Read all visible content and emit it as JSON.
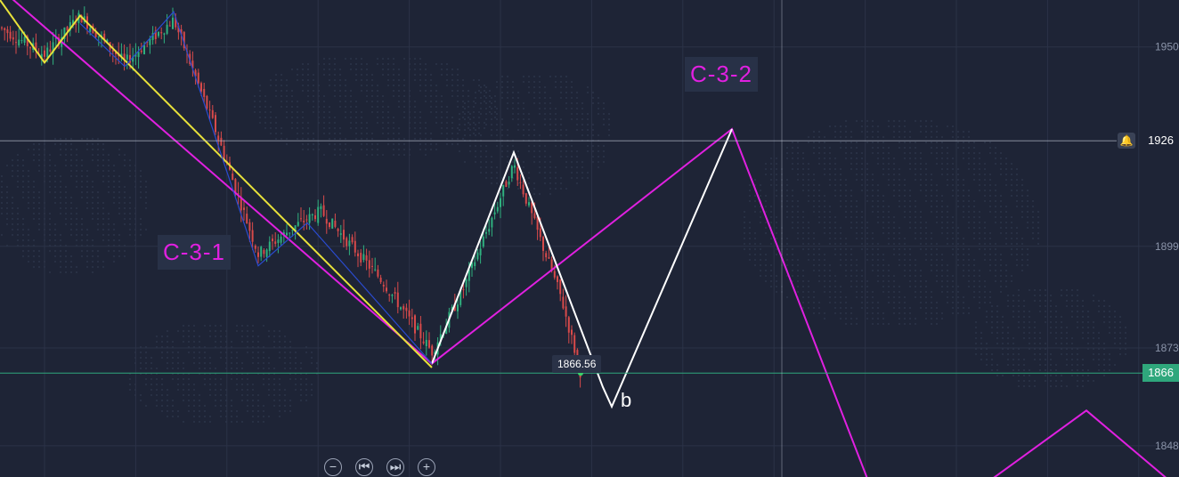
{
  "chart_data": {
    "type": "candlestick",
    "title": "",
    "xlabel": "",
    "ylabel": "",
    "ylim": [
      1840,
      1962
    ],
    "price_axis_ticks": [
      "1950",
      "1926",
      "1899",
      "1873",
      "1866",
      "1848"
    ],
    "current_price": 1866.56,
    "current_price_label": "1866",
    "crosshair_price_label": "1926",
    "tooltip_value": "1866.56",
    "grid": true,
    "wave_labels": [
      "C-3-1",
      "C-3-2",
      "b"
    ],
    "candles_desc": "downtrend then rebound then decline",
    "series": [
      {
        "name": "",
        "color": "#e020e0",
        "points": [
          [
            0,
            1965
          ],
          [
            485,
            1869
          ],
          [
            822,
            1929
          ],
          [
            975,
            1839
          ]
        ]
      },
      {
        "name": "",
        "color": "#e020e0",
        "points": [
          [
            1105,
            1838
          ],
          [
            1220,
            1857
          ],
          [
            1324,
            1837
          ]
        ]
      },
      {
        "name": "",
        "color": "#ffffff",
        "points": [
          [
            485,
            1869
          ],
          [
            577,
            1923
          ],
          [
            677,
            1863
          ],
          [
            687,
            1858
          ],
          [
            822,
            1929
          ]
        ]
      },
      {
        "name": "",
        "color": "#e8e23a",
        "points": [
          [
            0,
            1962
          ],
          [
            50,
            1946
          ],
          [
            90,
            1958
          ],
          [
            485,
            1868
          ]
        ]
      },
      {
        "name": "",
        "color": "#2a4bd0",
        "points": [
          [
            90,
            1956
          ],
          [
            140,
            1945
          ],
          [
            195,
            1959
          ],
          [
            290,
            1894
          ],
          [
            345,
            1905
          ],
          [
            485,
            1869
          ]
        ]
      }
    ]
  },
  "ui": {
    "alert_icon": "bell-icon",
    "controls": [
      {
        "name": "zoom-out-button",
        "glyph": "−"
      },
      {
        "name": "scroll-start-button",
        "glyph": "⏮"
      },
      {
        "name": "scroll-end-button",
        "glyph": "⏭"
      },
      {
        "name": "zoom-in-button",
        "glyph": "+"
      }
    ],
    "colors": {
      "background": "#1e2436",
      "grid": "#2b3247",
      "up_candle": "#2fb17f",
      "down_candle": "#d84a4a",
      "current_price_line": "#2fa77c"
    }
  }
}
